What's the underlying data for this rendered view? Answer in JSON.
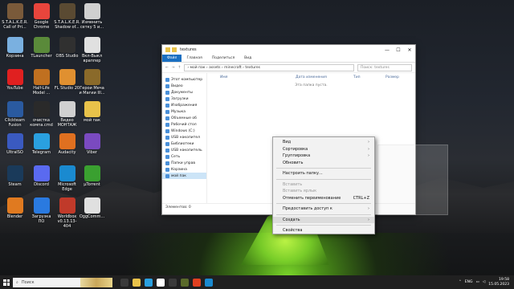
{
  "desktop": {
    "icons": [
      {
        "label": "S.T.A.L.K.E.R. Call of Pri...",
        "color": "#7a5a3a"
      },
      {
        "label": "Google Chrome",
        "color": "#e8453c"
      },
      {
        "label": "S.T.A.L.K.E.R. Shadow of...",
        "color": "#5a4a32"
      },
      {
        "label": "Изменить сетку 5 и...",
        "color": "#d0d0d0"
      },
      {
        "label": "Корзина",
        "color": "#7ab0e0"
      },
      {
        "label": "TLauncher",
        "color": "#5a8a3a"
      },
      {
        "label": "OBS Studio",
        "color": "#303030"
      },
      {
        "label": "Вкл-Выкл враппер",
        "color": "#e0e0e0"
      },
      {
        "label": "YouTube",
        "color": "#e02020"
      },
      {
        "label": "Half-Life Model ...",
        "color": "#c07020"
      },
      {
        "label": "FL Studio 20",
        "color": "#e09030"
      },
      {
        "label": "Герои Меча и Магии III...",
        "color": "#8a6a2a"
      },
      {
        "label": "Clickteam Fusion",
        "color": "#2a5aa0"
      },
      {
        "label": "очистка компа.cmd",
        "color": "#2a2a2a"
      },
      {
        "label": "Видео МОНТАЖ",
        "color": "#d0d0d0"
      },
      {
        "label": "мой пак",
        "color": "#e8c24a"
      },
      {
        "label": "UltraISO",
        "color": "#3a5ac0"
      },
      {
        "label": "Telegram",
        "color": "#2aa0e0"
      },
      {
        "label": "Audacity",
        "color": "#e07020"
      },
      {
        "label": "Viber",
        "color": "#7a4ac0"
      },
      {
        "label": "Steam",
        "color": "#1a3a5a"
      },
      {
        "label": "Discord",
        "color": "#5a6af0"
      },
      {
        "label": "Microsoft Edge",
        "color": "#1a8ad0"
      },
      {
        "label": "µTorrent",
        "color": "#3aa030"
      },
      {
        "label": "Blender",
        "color": "#e07a20"
      },
      {
        "label": "Загрузка ПО",
        "color": "#2a7ae0"
      },
      {
        "label": "Worldbox v0.13.13-404",
        "color": "#c03a2a"
      },
      {
        "label": "OggComm...",
        "color": "#e0e0e0"
      }
    ]
  },
  "explorer": {
    "title": "textures",
    "controls": {
      "minimize": "—",
      "maximize": "☐",
      "close": "✕"
    },
    "ribbon_tabs": [
      "Файл",
      "Главная",
      "Поделиться",
      "Вид"
    ],
    "path": "› мой пак › assets › minecraft › textures",
    "search_placeholder": "Поиск: textures",
    "columns": [
      "Имя",
      "Дата изменения",
      "Тип",
      "Размер"
    ],
    "empty_message": "Эта папка пуста.",
    "nav_items": [
      "Этот компьютер",
      "Видео",
      "Документы",
      "Загрузки",
      "Изображения",
      "Музыка",
      "Объемные об",
      "Рабочий стол",
      "Windows (C:)",
      "USB накопител",
      "Библиотеки",
      "USB накопитель",
      "Сеть",
      "Папки управ",
      "Корзина",
      "мой пак"
    ],
    "status": "Элементов: 0"
  },
  "context_menu": {
    "items": [
      {
        "label": "Вид",
        "arrow": true,
        "disabled": false
      },
      {
        "label": "Сортировка",
        "arrow": true,
        "disabled": false
      },
      {
        "label": "Группировка",
        "arrow": true,
        "disabled": false
      },
      {
        "label": "Обновить",
        "arrow": false,
        "disabled": false
      },
      {
        "sep": true
      },
      {
        "label": "Настроить папку...",
        "arrow": false,
        "disabled": false
      },
      {
        "sep": true
      },
      {
        "label": "Вставить",
        "arrow": false,
        "disabled": true
      },
      {
        "label": "Вставить ярлык",
        "arrow": false,
        "disabled": true
      },
      {
        "label": "Отменить переименование",
        "shortcut": "CTRL+Z",
        "arrow": false,
        "disabled": false
      },
      {
        "sep": true
      },
      {
        "label": "Предоставить доступ к",
        "arrow": true,
        "disabled": false
      },
      {
        "sep": true
      },
      {
        "label": "Создать",
        "arrow": true,
        "disabled": false,
        "highlight": true
      },
      {
        "sep": true
      },
      {
        "label": "Свойства",
        "arrow": false,
        "disabled": false
      }
    ]
  },
  "taskbar": {
    "search_placeholder": "Поиск",
    "apps": [
      "#3a3a3a",
      "#e8c24a",
      "#2aa0e0",
      "#ffffff",
      "#3a3a3a",
      "#5a6a2a",
      "#e04020",
      "#1a8ad0"
    ],
    "language": "ENG",
    "time": "19:58",
    "date": "15.05.2023"
  }
}
